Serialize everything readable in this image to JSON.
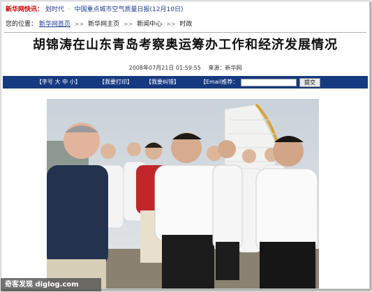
{
  "topbar": {
    "flash_label": "新华网快讯：",
    "item1": "划时代",
    "item2": "中国重点城市空气质量日报(12月10日)"
  },
  "breadcrumb": {
    "prefix": "您的位置：",
    "items": [
      "新华网首页",
      "新华网主页",
      "新闻中心",
      "时政"
    ]
  },
  "article": {
    "title": "胡锦涛在山东青岛考察奥运筹办工作和经济发展情况",
    "datetime": "2008年07月21日  01:59:55",
    "source": "来源：新华网"
  },
  "toolbar": {
    "font_size": "【字号 大 中 小】",
    "print": "【我要打印】",
    "correct": "【我要纠错】",
    "email_label": "【Email推荐：",
    "submit": "提交"
  },
  "colors": {
    "toolbar_bg": "#163a80",
    "link": "#1a3c8c",
    "flash": "#cc0000"
  },
  "watermark": "奇客发现 diglog.com"
}
